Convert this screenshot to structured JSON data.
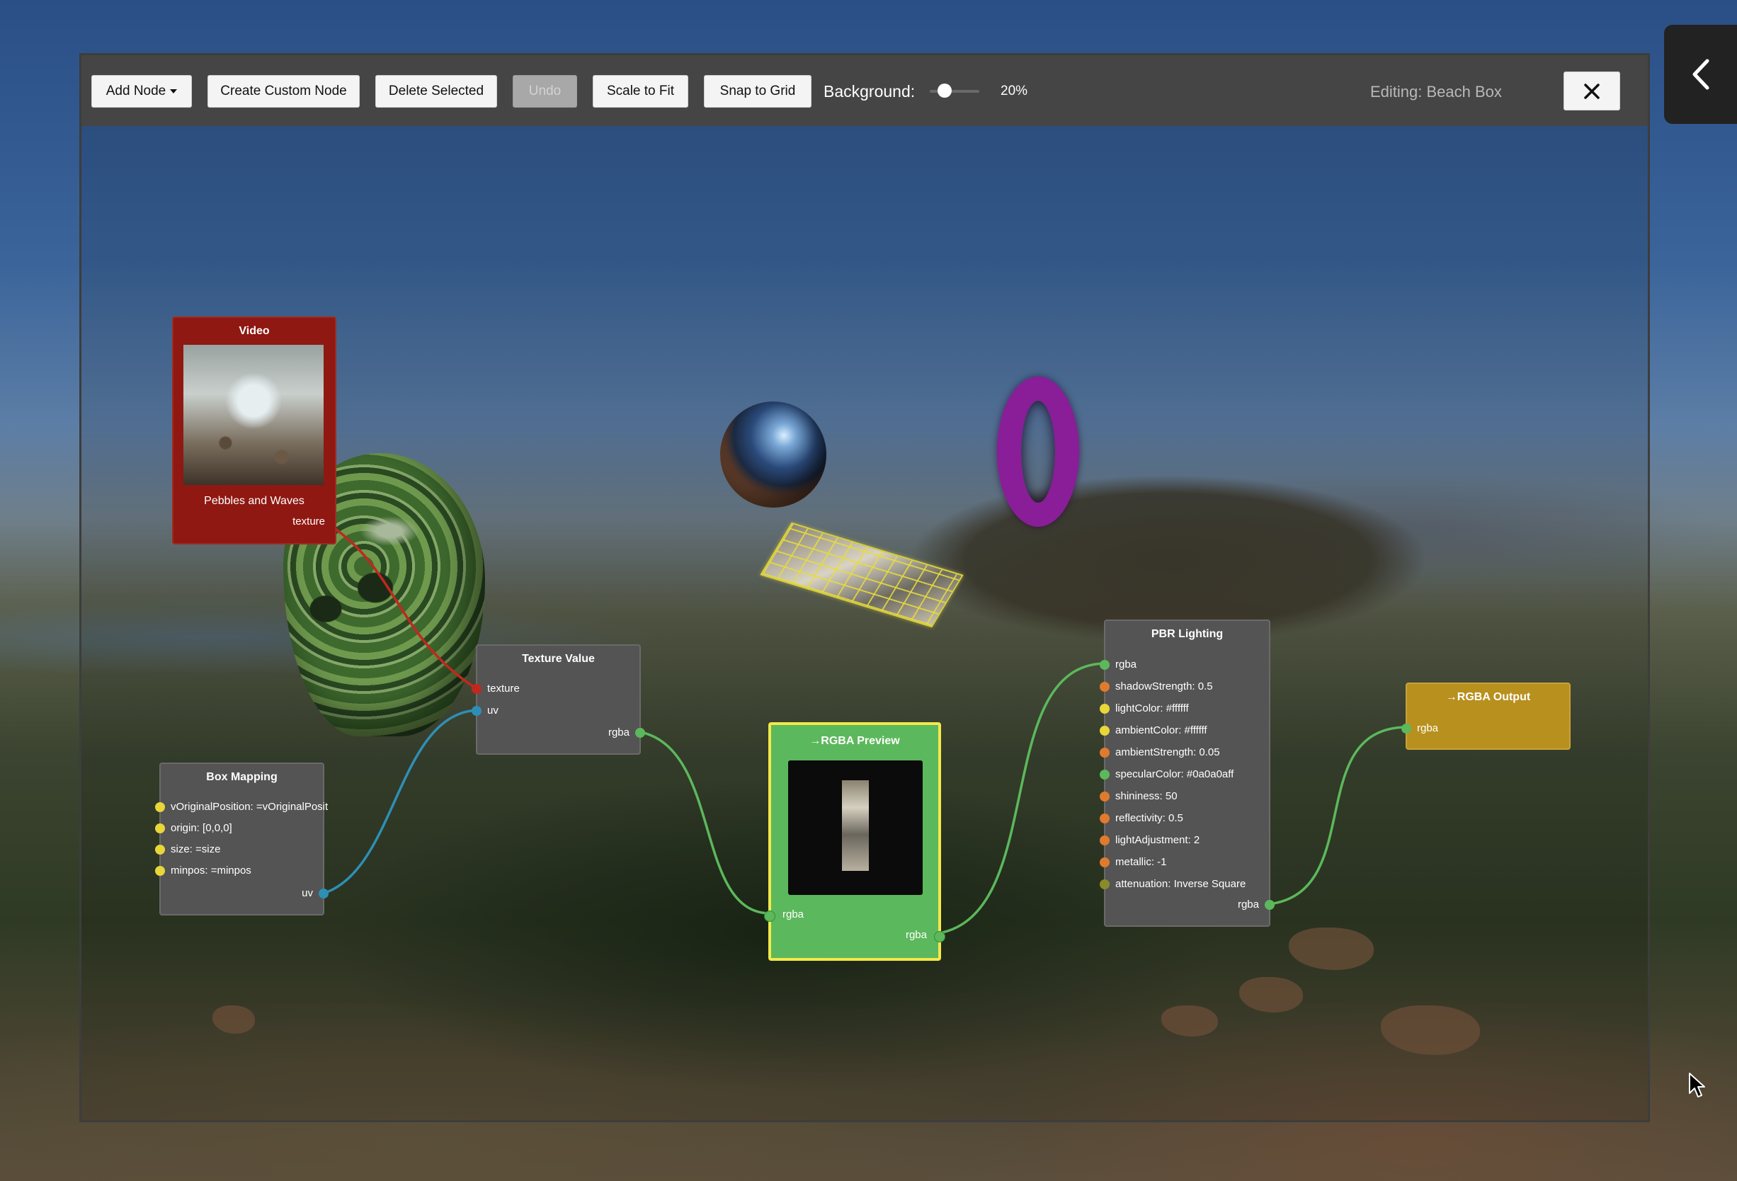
{
  "toolbar": {
    "add_node_label": "Add Node",
    "create_custom_node_label": "Create Custom Node",
    "delete_selected_label": "Delete Selected",
    "undo_label": "Undo",
    "scale_to_fit_label": "Scale to Fit",
    "snap_to_grid_label": "Snap to Grid",
    "background_label": "Background:",
    "background_value": "20%",
    "background_level": 0.2,
    "editing_label": "Editing: Beach Box",
    "close_icon": "close-icon"
  },
  "side_tab": {
    "icon": "chevron-left-icon"
  },
  "nodes": {
    "video": {
      "title": "Video",
      "caption": "Pebbles and Waves",
      "out_texture": "texture",
      "color": "#8f1812"
    },
    "texture_value": {
      "title": "Texture Value",
      "in_texture": "texture",
      "in_uv": "uv",
      "out_rgba": "rgba"
    },
    "box_mapping": {
      "title": "Box Mapping",
      "inputs": [
        "vOriginalPosition: =vOriginalPosit",
        "origin: [0,0,0]",
        "size: =size",
        "minpos: =minpos"
      ],
      "out_uv": "uv"
    },
    "rgba_preview": {
      "title": "→RGBA Preview",
      "in_rgba": "rgba",
      "out_rgba": "rgba",
      "color": "#5cb85c"
    },
    "pbr_lighting": {
      "title": "PBR Lighting",
      "in_rgba": "rgba",
      "inputs": [
        "shadowStrength: 0.5",
        "lightColor: #ffffff",
        "ambientColor: #ffffff",
        "ambientStrength: 0.05",
        "specularColor: #0a0a0aff",
        "shininess: 50",
        "reflectivity: 0.5",
        "lightAdjustment: 2",
        "metallic: -1",
        "attenuation: Inverse Square"
      ],
      "out_rgba": "rgba"
    },
    "rgba_output": {
      "title": "→RGBA Output",
      "in_rgba": "rgba",
      "color": "#b8901e"
    }
  },
  "colors": {
    "port_yellow": "#e8d63a",
    "port_orange": "#e07a2e",
    "port_green": "#5cb85c",
    "port_red": "#c0281e",
    "port_blue": "#2e8fb5",
    "port_olive": "#8a8a2a"
  }
}
